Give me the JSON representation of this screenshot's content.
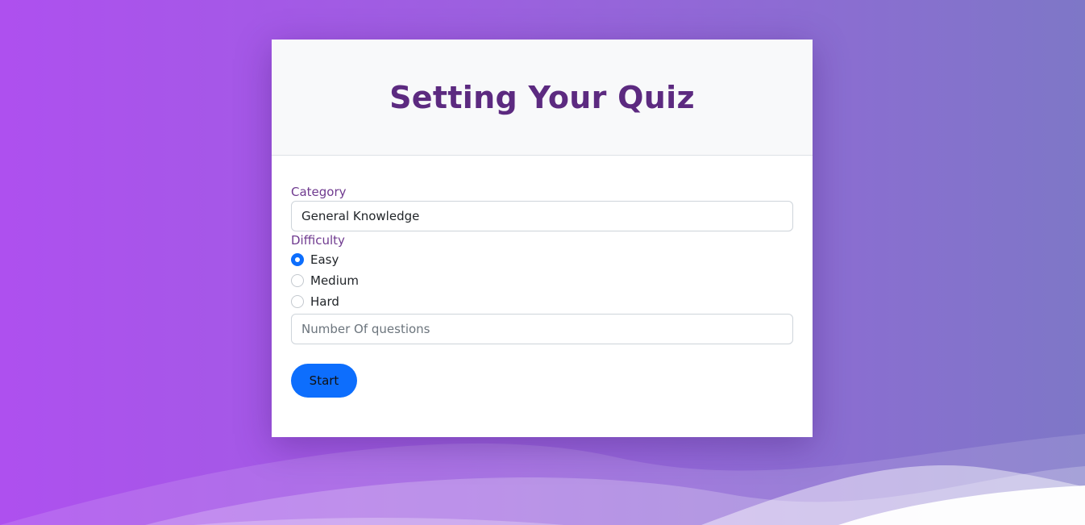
{
  "card": {
    "title": "Setting Your Quiz"
  },
  "form": {
    "category_label": "Category",
    "category_value": "General Knowledge",
    "difficulty_label": "Difficulty",
    "difficulty_options": [
      {
        "label": "Easy",
        "checked": true
      },
      {
        "label": "Medium",
        "checked": false
      },
      {
        "label": "Hard",
        "checked": false
      }
    ],
    "questions_placeholder": "Number Of questions",
    "start_label": "Start"
  },
  "colors": {
    "background_start": "#ae50ef",
    "background_end": "#7e77c7",
    "title": "#5c2a80",
    "label": "#6f3a8f",
    "accent": "#0d6efd"
  }
}
